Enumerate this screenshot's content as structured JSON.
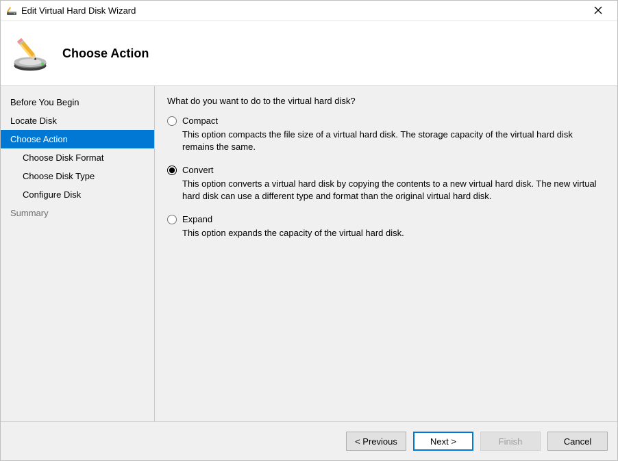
{
  "titlebar": {
    "title": "Edit Virtual Hard Disk Wizard"
  },
  "header": {
    "heading": "Choose Action"
  },
  "sidebar": {
    "items": [
      {
        "label": "Before You Begin",
        "active": false,
        "indent": false,
        "cls": ""
      },
      {
        "label": "Locate Disk",
        "active": false,
        "indent": false,
        "cls": ""
      },
      {
        "label": "Choose Action",
        "active": true,
        "indent": false,
        "cls": ""
      },
      {
        "label": "Choose Disk Format",
        "active": false,
        "indent": true,
        "cls": ""
      },
      {
        "label": "Choose Disk Type",
        "active": false,
        "indent": true,
        "cls": ""
      },
      {
        "label": "Configure Disk",
        "active": false,
        "indent": true,
        "cls": ""
      },
      {
        "label": "Summary",
        "active": false,
        "indent": false,
        "cls": "summary"
      }
    ]
  },
  "content": {
    "question": "What do you want to do to the virtual hard disk?",
    "options": [
      {
        "name": "compact",
        "label": "Compact",
        "desc": "This option compacts the file size of a virtual hard disk. The storage capacity of the virtual hard disk remains the same.",
        "checked": false
      },
      {
        "name": "convert",
        "label": "Convert",
        "desc": "This option converts a virtual hard disk by copying the contents to a new virtual hard disk. The new virtual hard disk can use a different type and format than the original virtual hard disk.",
        "checked": true
      },
      {
        "name": "expand",
        "label": "Expand",
        "desc": "This option expands the capacity of the virtual hard disk.",
        "checked": false
      }
    ]
  },
  "buttons": {
    "previous": "< Previous",
    "next": "Next >",
    "finish": "Finish",
    "cancel": "Cancel"
  }
}
